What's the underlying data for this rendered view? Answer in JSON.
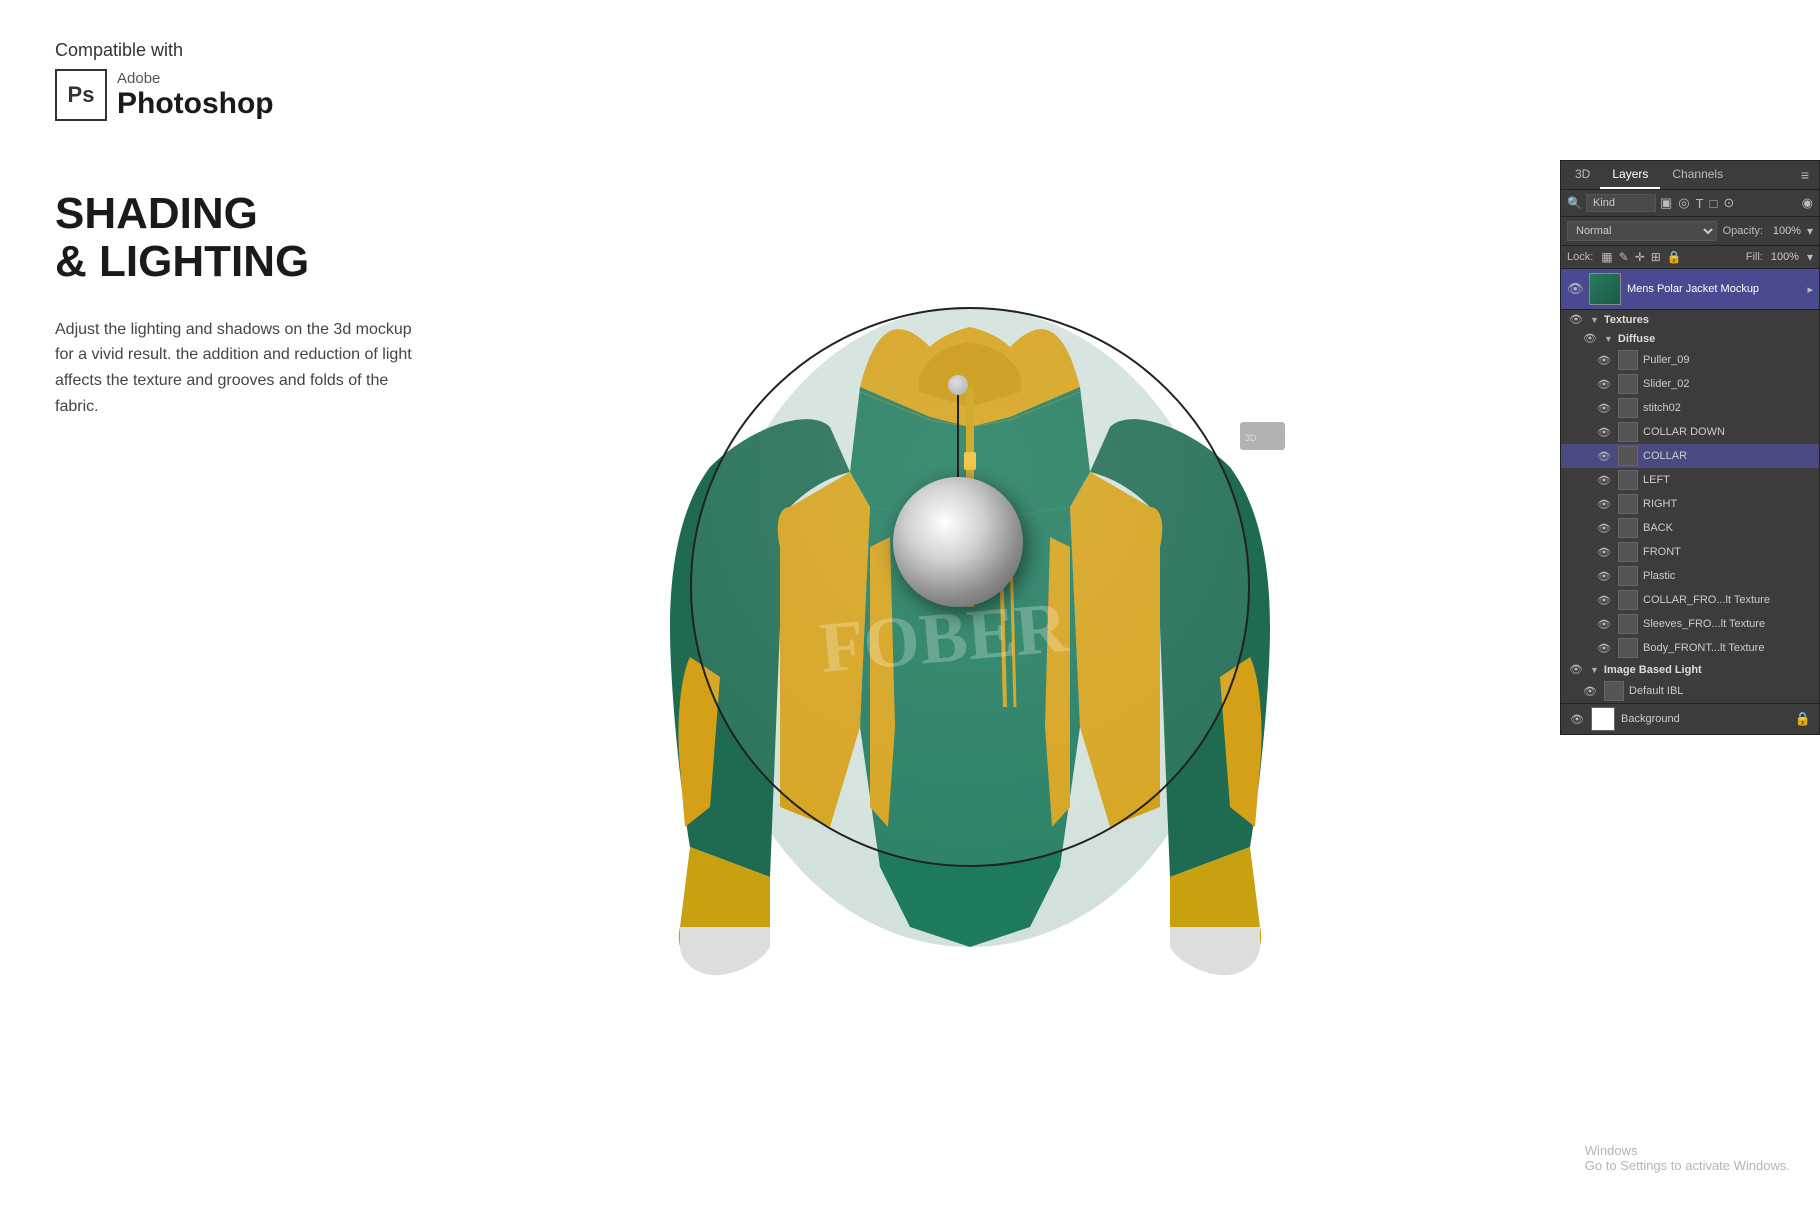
{
  "branding": {
    "compatible_with": "Compatible with",
    "ps_label": "Ps",
    "adobe_label": "Adobe",
    "photoshop_label": "Photoshop"
  },
  "shading": {
    "title_line1": "SHADING",
    "title_line2": "& LIGHTING",
    "description": "Adjust the lighting and shadows on the 3d mockup for a vivid result. the addition and reduction of light affects the texture and grooves and folds of the fabric."
  },
  "panel": {
    "tab_3d": "3D",
    "tab_layers": "Layers",
    "tab_channels": "Channels",
    "search_label": "Kind",
    "blend_mode": "Normal",
    "opacity_label": "Opacity:",
    "opacity_value": "100%",
    "lock_label": "Lock:",
    "fill_label": "Fill:",
    "fill_value": "100%",
    "main_layer_name": "Mens Polar Jacket Mockup",
    "layers": [
      {
        "type": "group",
        "name": "Textures",
        "expanded": true,
        "indent": 0
      },
      {
        "type": "group",
        "name": "Diffuse",
        "expanded": true,
        "indent": 1
      },
      {
        "type": "item",
        "name": "Puller_09",
        "indent": 2
      },
      {
        "type": "item",
        "name": "Slider_02",
        "indent": 2
      },
      {
        "type": "item",
        "name": "stitch02",
        "indent": 2
      },
      {
        "type": "item",
        "name": "COLLAR DOWN",
        "indent": 2
      },
      {
        "type": "item",
        "name": "COLLAR",
        "indent": 2,
        "selected": true
      },
      {
        "type": "item",
        "name": "LEFT",
        "indent": 2
      },
      {
        "type": "item",
        "name": "RIGHT",
        "indent": 2
      },
      {
        "type": "item",
        "name": "BACK",
        "indent": 2
      },
      {
        "type": "item",
        "name": "FRONT",
        "indent": 2
      },
      {
        "type": "item",
        "name": "Plastic",
        "indent": 2
      },
      {
        "type": "item",
        "name": "COLLAR_FRO...lt Texture",
        "indent": 2
      },
      {
        "type": "item",
        "name": "Sleeves_FRO...lt Texture",
        "indent": 2
      },
      {
        "type": "item",
        "name": "Body_FRONT...lt Texture",
        "indent": 2
      },
      {
        "type": "group",
        "name": "Image Based Light",
        "expanded": true,
        "indent": 0
      },
      {
        "type": "item",
        "name": "Default IBL",
        "indent": 1
      }
    ],
    "bg_layer": "Background"
  }
}
